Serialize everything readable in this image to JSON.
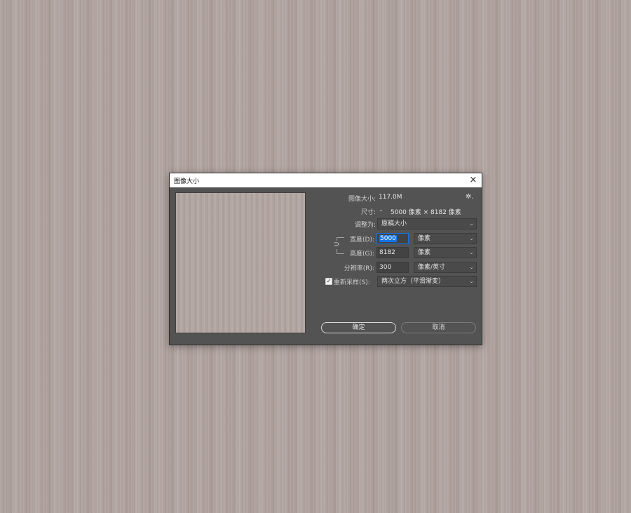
{
  "dialog": {
    "title": "图像大小",
    "close_icon": "×",
    "image_size_label": "图像大小:",
    "image_size_value": "117.0M",
    "gear_icon": "✲.",
    "dimensions_label": "尺寸:",
    "dimensions_chevron": "⌄",
    "dimensions_value": "5000 像素 × 8182 像素",
    "fit_to_label": "调整为:",
    "fit_to_value": "原稿大小",
    "width_label": "宽度(D):",
    "width_value": "5000",
    "width_unit": "像素",
    "height_label": "高度(G):",
    "height_value": "8182",
    "height_unit": "像素",
    "resolution_label": "分辨率(R):",
    "resolution_value": "300",
    "resolution_unit": "像素/英寸",
    "resample_label": "重新采样(S):",
    "resample_checked": true,
    "resample_value": "两次立方（平滑渐变）",
    "chevron": "⌄",
    "link_icon": "⊃",
    "ok_label": "确定",
    "cancel_label": "取消"
  }
}
